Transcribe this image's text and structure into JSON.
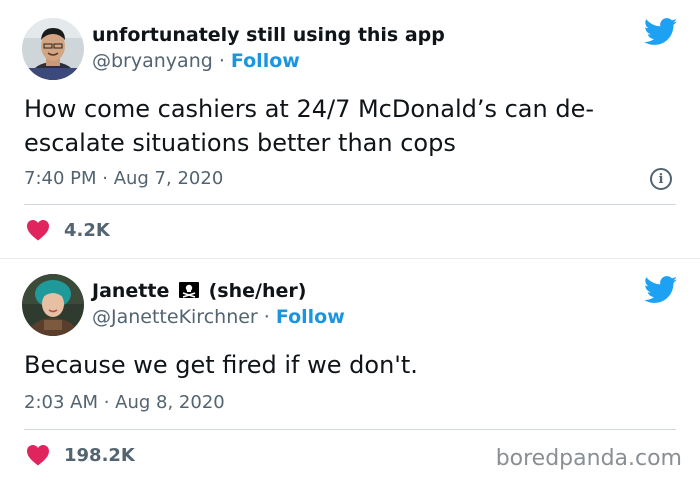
{
  "tweets": [
    {
      "display_name": "unfortunately still using this app",
      "handle": "@bryanyang",
      "follow_label": "Follow",
      "text": "How come cashiers at 24/7 McDonald’s can de-escalate situations better than cops",
      "timestamp": "7:40 PM · Aug 7, 2020",
      "likes": "4.2K"
    },
    {
      "display_name": "Janette",
      "name_suffix": "(she/her)",
      "handle": "@JanetteKirchner",
      "follow_label": "Follow",
      "text": "Because we get fired if we don't.",
      "timestamp": "2:03 AM · Aug 8, 2020",
      "likes": "198.2K"
    }
  ],
  "separator": " · ",
  "watermark": "boredpanda.com",
  "icons": {
    "twitter": "twitter-bird-icon",
    "info": "info-icon",
    "like": "heart-icon",
    "emoji": "pirate-flag-emoji"
  },
  "colors": {
    "twitter_blue": "#1da1f2",
    "follow_blue": "#1b95e0",
    "heart": "#e0245e",
    "secondary_text": "#536471"
  }
}
